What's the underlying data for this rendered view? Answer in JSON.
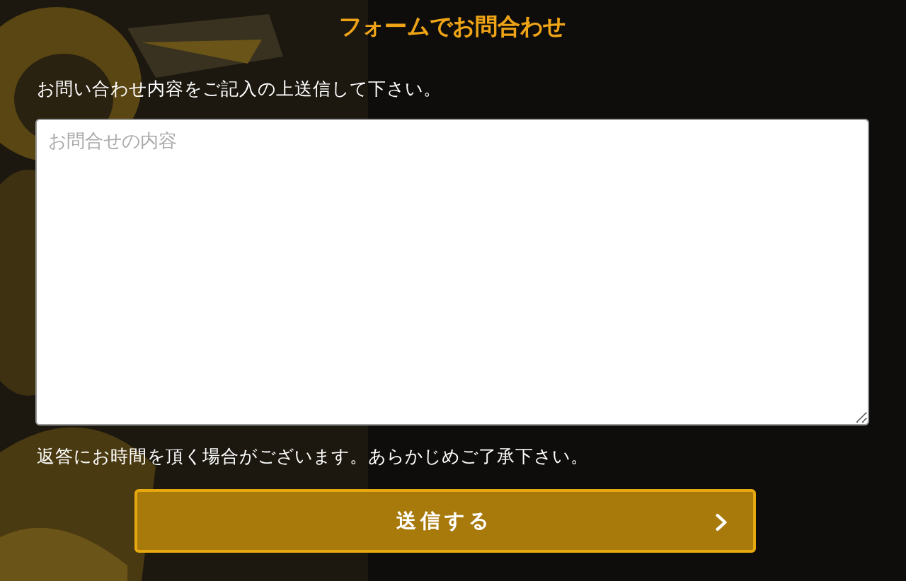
{
  "heading": "フォームでお問合わせ",
  "intro": "お問い合わせ内容をご記入の上送信して下さい。",
  "message_field": {
    "placeholder": "お問合せの内容"
  },
  "note": "返答にお時間を頂く場合がございます。あらかじめご了承下さい。",
  "submit_button": {
    "label": "送信する"
  }
}
